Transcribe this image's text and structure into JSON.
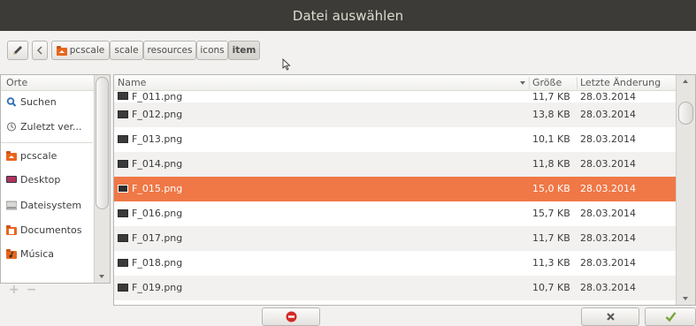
{
  "window": {
    "title": "Datei auswählen"
  },
  "pathbar": {
    "edit_icon": "pencil-icon",
    "back_icon": "chevron-left-icon",
    "crumbs": [
      {
        "label": "pcscale",
        "icon": "home-folder-icon"
      },
      {
        "label": "scale"
      },
      {
        "label": "resources"
      },
      {
        "label": "icons"
      },
      {
        "label": "item",
        "active": true
      }
    ]
  },
  "places": {
    "header": "Orte",
    "items": [
      {
        "label": "Suchen",
        "icon": "search-icon"
      },
      {
        "label": "Zuletzt ver...",
        "icon": "recent-icon"
      },
      {
        "label": "pcscale",
        "icon": "home-folder-icon"
      },
      {
        "label": "Desktop",
        "icon": "desktop-icon"
      },
      {
        "label": "Dateisystem",
        "icon": "drive-icon"
      },
      {
        "label": "Documentos",
        "icon": "documents-folder-icon"
      },
      {
        "label": "Música",
        "icon": "music-folder-icon"
      }
    ],
    "add_icon": "add-icon",
    "remove_icon": "remove-icon"
  },
  "files": {
    "columns": {
      "name": "Name",
      "size": "Größe",
      "modified": "Letzte Änderung"
    },
    "sort_icon": "sort-descending-icon",
    "rows": [
      {
        "name": "F_011.png",
        "size": "11,7 KB",
        "modified": "28.03.2014"
      },
      {
        "name": "F_012.png",
        "size": "13,8 KB",
        "modified": "28.03.2014"
      },
      {
        "name": "F_013.png",
        "size": "10,1 KB",
        "modified": "28.03.2014"
      },
      {
        "name": "F_014.png",
        "size": "11,8 KB",
        "modified": "28.03.2014"
      },
      {
        "name": "F_015.png",
        "size": "15,0 KB",
        "modified": "28.03.2014",
        "selected": true
      },
      {
        "name": "F_016.png",
        "size": "15,7 KB",
        "modified": "28.03.2014"
      },
      {
        "name": "F_017.png",
        "size": "11,7 KB",
        "modified": "28.03.2014"
      },
      {
        "name": "F_018.png",
        "size": "11,3 KB",
        "modified": "28.03.2014"
      },
      {
        "name": "F_019.png",
        "size": "10,7 KB",
        "modified": "28.03.2014"
      }
    ]
  },
  "buttons": {
    "middle_icon": "no-entry-icon",
    "cancel_icon": "close-x-icon",
    "ok_icon": "checkmark-icon"
  },
  "colors": {
    "titlebar": "#3c3b37",
    "selection": "#f07746",
    "no_entry": "#d42a27",
    "checkmark": "#7aa43a"
  }
}
